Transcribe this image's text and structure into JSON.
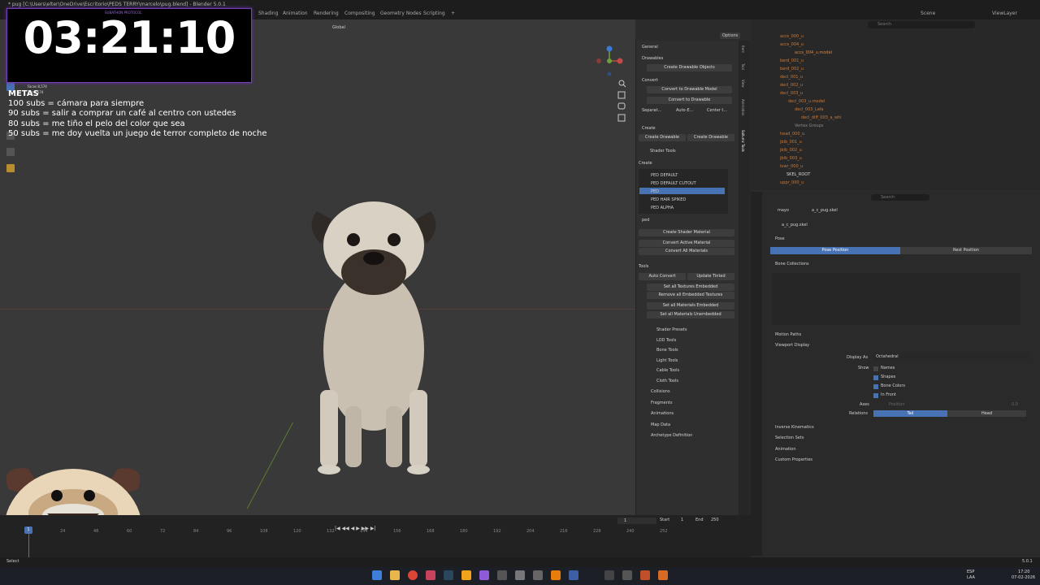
{
  "titlebar": {
    "title": "* pug [C:\\Users\\elter\\OneDrive\\Escritorio\\PEDS TERRY\\marcelo\\pug.blend] - Blender 5.0.1"
  },
  "workspaces": [
    "Shading",
    "Animation",
    "Rendering",
    "Compositing",
    "Geometry Nodes",
    "Scripting"
  ],
  "scene": {
    "label": "Scene",
    "viewlayer": "ViewLayer"
  },
  "viewport": {
    "transform": "Global",
    "options": "Options"
  },
  "overlay": {
    "timer": "03:21:10",
    "subathon": "SUBATHON PROTOCOL",
    "goals_title": "METAS",
    "goals": [
      "100 subs = cámara para siempre",
      "90 subs = salir a comprar un café al centro con ustedes",
      "80 subs = me tiño el pelo del color que sea",
      "50 subs = me doy vuelta un juego de terror completo de noche"
    ],
    "stats": [
      "Faces 8,574",
      "Tris 8,574"
    ]
  },
  "npanel": {
    "general": "General",
    "drawables": "Drawables",
    "create_drawable_objects": "Create Drawable Objects",
    "convert": "Convert",
    "convert_to_drawable_model": "Convert to Drawable Model",
    "convert_to_drawable": "Convert to Drawable",
    "separate": "Separat...",
    "auto_e": "Auto-E...",
    "center_t": "Center t...",
    "create": "Create",
    "create_drawable": "Create Drawable",
    "create_drawable2": "Create Drawable",
    "shader_tools": "Shader Tools",
    "create_label": "Create",
    "shaders": [
      "PED DEFAULT",
      "PED DEFAULT CUTOUT",
      "PED",
      "PED HAIR SPIKED",
      "PED ALPHA"
    ],
    "filter": "ped",
    "create_shader_material": "Create Shader Material",
    "convert_active_material": "Convert Active Material",
    "convert_all_materials": "Convert All Materials",
    "tools": "Tools",
    "auto_convert": "Auto Convert",
    "update_tinted": "Update Tinted",
    "set_all_textures_embedded": "Set all Textures Embedded",
    "remove_all_embedded": "Remove all Embedded Textures",
    "set_all_materials_embedded": "Set all Materials Embedded",
    "set_all_materials_unembedded": "Set all Materials Unembedded",
    "sections": [
      "Shader Presets",
      "LOD Tools",
      "Bone Tools",
      "Light Tools",
      "Cable Tools",
      "Cloth Tools"
    ],
    "bottom": [
      "Collisions",
      "Fragments",
      "Animations",
      "Map Data",
      "Archetype Definition"
    ]
  },
  "side_tabs": [
    "Item",
    "Tool",
    "View",
    "Animation",
    "Sollumz Tools"
  ],
  "outliner": {
    "search": "Search",
    "items": [
      {
        "name": "accs_000_u",
        "color": "#c97a3a"
      },
      {
        "name": "accs_004_u",
        "color": "#c97a3a"
      },
      {
        "name": "accs_004_u.model",
        "color": "#d58a4a"
      },
      {
        "name": "berd_001_u",
        "color": "#c97a3a"
      },
      {
        "name": "berd_002_u",
        "color": "#c97a3a"
      },
      {
        "name": "decl_001_u",
        "color": "#c97a3a"
      },
      {
        "name": "decl_002_u",
        "color": "#c97a3a"
      },
      {
        "name": "decl_003_u",
        "color": "#c97a3a"
      },
      {
        "name": "decl_003_u.model",
        "color": "#c97a3a"
      },
      {
        "name": "decl_003_Lafa",
        "color": "#c97a3a"
      },
      {
        "name": "decl_diff_003_a_whi",
        "color": "#c97a3a"
      },
      {
        "name": "Vertex Groups",
        "color": "#888888"
      },
      {
        "name": "head_000_u",
        "color": "#c97a3a"
      },
      {
        "name": "jbib_001_u",
        "color": "#c97a3a"
      },
      {
        "name": "jbib_002_u",
        "color": "#c97a3a"
      },
      {
        "name": "jbib_003_u",
        "color": "#c97a3a"
      },
      {
        "name": "lowr_000_u",
        "color": "#c97a3a"
      },
      {
        "name": "SKEL_ROOT",
        "color": "#d8d8d8"
      },
      {
        "name": "uppr_000_u",
        "color": "#c97a3a"
      }
    ]
  },
  "properties": {
    "search": "Search",
    "breadcrumb": [
      "mayo",
      "a_c_pug.skel"
    ],
    "object": "a_c_pug.skel",
    "pose": "Pose",
    "pose_position": "Pose Position",
    "rest_position": "Rest Position",
    "bone_collections": "Bone Collections",
    "motion_paths": "Motion Paths",
    "viewport_display": "Viewport Display",
    "display_as_label": "Display As",
    "display_as_value": "Octahedral",
    "show": "Show",
    "names": "Names",
    "shapes": "Shapes",
    "bone_colors": "Bone Colors",
    "in_front": "In Front",
    "axes": "Axes",
    "position": "Position",
    "axes_value": "0.0",
    "relations": "Relations",
    "tail": "Tail",
    "head": "Head",
    "more": [
      "Inverse Kinematics",
      "Selection Sets",
      "Animation",
      "Custom Properties"
    ]
  },
  "timeline": {
    "frame": "1",
    "start_label": "Start",
    "start": "1",
    "end_label": "End",
    "end": "250",
    "ticks": [
      "1",
      "24",
      "48",
      "60",
      "72",
      "84",
      "96",
      "108",
      "120",
      "132",
      "144",
      "156",
      "168",
      "180",
      "192",
      "204",
      "216",
      "228",
      "240",
      "252"
    ],
    "current": "1"
  },
  "status": {
    "select": "Select",
    "version": "5.0.1"
  },
  "taskbar": {
    "lang": "ESP",
    "region": "LAA",
    "time": "17:20",
    "date": "07-02-2026"
  }
}
